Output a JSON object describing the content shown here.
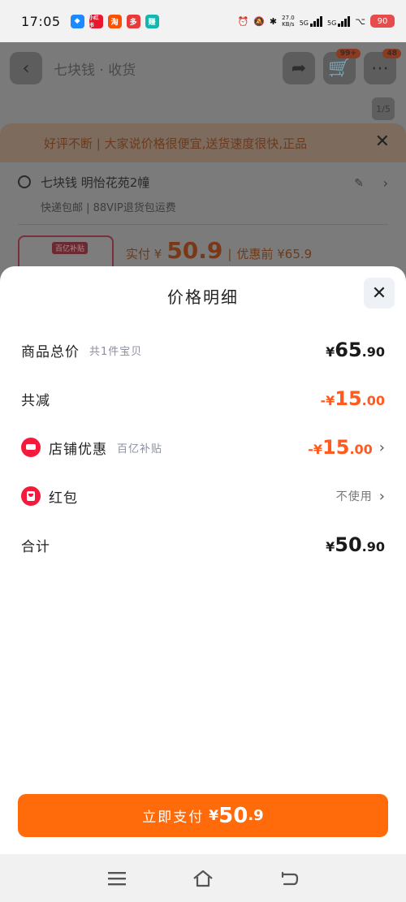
{
  "status_bar": {
    "time": "17:05",
    "app_icons": [
      {
        "name": "app-icon-1",
        "color": "#1a8cff",
        "text": ""
      },
      {
        "name": "app-icon-2",
        "color": "#e8192c",
        "text": "小红书"
      },
      {
        "name": "app-icon-3",
        "color": "#ff5000",
        "text": "淘"
      },
      {
        "name": "app-icon-4",
        "color": "#e83a3a",
        "text": "多"
      },
      {
        "name": "app-icon-5",
        "color": "#12b7b0",
        "text": "赚"
      }
    ],
    "net_speed": "27.0\nKB/s",
    "battery": "90"
  },
  "background_page": {
    "title": "七块钱 · 收货",
    "cart_badge": "99+",
    "msg_badge": "48",
    "pager": "1/5",
    "promo_text": "好评不断 | 大家说价格很便宜,送货速度很快,正品",
    "address": "七块钱 明怡花苑2幢",
    "shipping": "快递包邮 | 88VIP退货包运费",
    "product_badge": "百亿补贴",
    "pay_label": "实付 ¥",
    "pay_amount": "50.9",
    "pay_before": "优惠前 ¥65.9"
  },
  "sheet": {
    "title": "价格明细",
    "rows": [
      {
        "label": "商品总价",
        "sub": "共1件宝贝",
        "currency": "¥",
        "int": "65",
        "dec": ".90"
      },
      {
        "label": "共减",
        "sub": "",
        "currency": "-¥",
        "int": "15",
        "dec": ".00"
      },
      {
        "label": "店铺优惠",
        "sub": "百亿补贴",
        "currency": "-¥",
        "int": "15",
        "dec": ".00"
      },
      {
        "label": "红包",
        "sub": "",
        "value": "不使用"
      },
      {
        "label": "合计",
        "sub": "",
        "currency": "¥",
        "int": "50",
        "dec": ".90"
      }
    ],
    "pay_button": {
      "label": "立即支付",
      "currency": "¥",
      "int": "50",
      "dec": ".9"
    }
  },
  "colors": {
    "accent": "#ff6a0a",
    "discount": "#ff5a1f",
    "icon_red": "#f5193b"
  }
}
